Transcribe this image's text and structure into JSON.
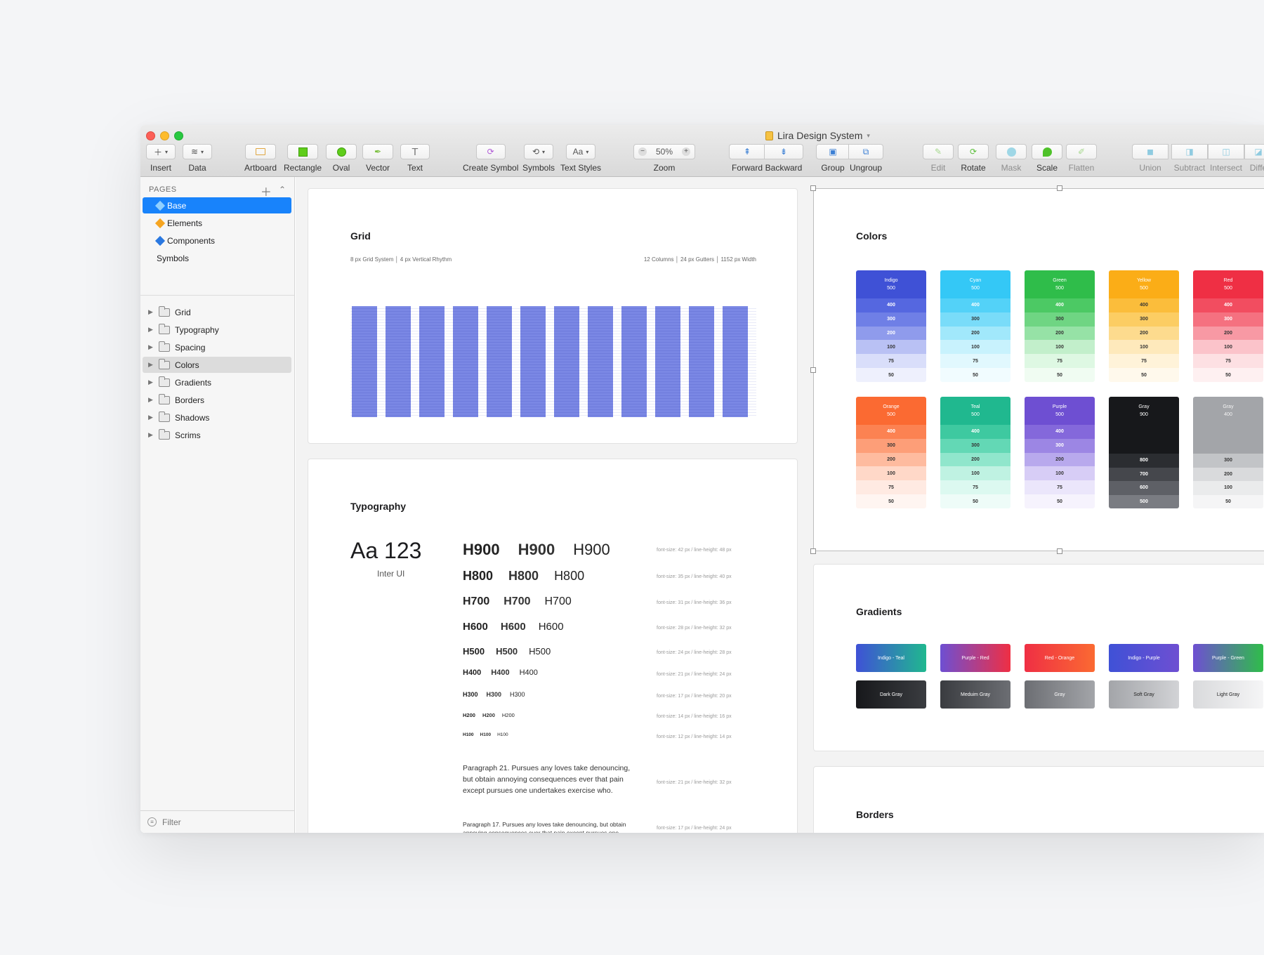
{
  "window": {
    "title": "Lira Design System"
  },
  "toolbar": {
    "insert": "Insert",
    "data": "Data",
    "artboard": "Artboard",
    "rectangle": "Rectangle",
    "oval": "Oval",
    "vector": "Vector",
    "text": "Text",
    "create_symbol": "Create Symbol",
    "symbols": "Symbols",
    "text_styles": "Text Styles",
    "text_styles_btn": "Aa",
    "zoom_label": "Zoom",
    "zoom_value": "50%",
    "forward": "Forward",
    "backward": "Backward",
    "group": "Group",
    "ungroup": "Ungroup",
    "edit": "Edit",
    "rotate": "Rotate",
    "mask": "Mask",
    "scale": "Scale",
    "flatten": "Flatten",
    "union": "Union",
    "subtract": "Subtract",
    "intersect": "Intersect",
    "difference": "Diffe"
  },
  "sidebar": {
    "pages_header": "PAGES",
    "pages": [
      "Base",
      "Elements",
      "Components",
      "Symbols"
    ],
    "layers": [
      "Grid",
      "Typography",
      "Spacing",
      "Colors",
      "Gradients",
      "Borders",
      "Shadows",
      "Scrims"
    ],
    "filter_placeholder": "Filter"
  },
  "grid": {
    "title": "Grid",
    "left_meta": "8 px Grid System │ 4 px Vertical Rhythm",
    "right_meta": "12 Columns │ 24 px Gutters │ 1152 px Width"
  },
  "typography": {
    "title": "Typography",
    "sample": "Aa 123",
    "font_name": "Inter UI",
    "headings": [
      {
        "label": "H900",
        "spec": "font-size: 42 px / line-height: 48 px"
      },
      {
        "label": "H800",
        "spec": "font-size: 35 px / line-height: 40 px"
      },
      {
        "label": "H700",
        "spec": "font-size: 31 px / line-height: 36 px"
      },
      {
        "label": "H600",
        "spec": "font-size: 28 px / line-height: 32 px"
      },
      {
        "label": "H500",
        "spec": "font-size: 24 px / line-height: 28 px"
      },
      {
        "label": "H400",
        "spec": "font-size: 21 px / line-height: 24 px"
      },
      {
        "label": "H300",
        "spec": "font-size: 17 px / line-height: 20 px"
      },
      {
        "label": "H200",
        "spec": "font-size: 14 px / line-height: 16 px"
      },
      {
        "label": "H100",
        "spec": "font-size: 12 px / line-height: 14 px"
      }
    ],
    "paragraph21": "Paragraph 21. Pursues any loves take denouncing, but obtain annoying consequences ever that pain except pursues one undertakes exercise who.",
    "paragraph21_spec": "font-size: 21 px / line-height: 32 px",
    "paragraph17": "Paragraph 17. Pursues any loves take denouncing, but obtain annoying consequences ever that pain except pursues one",
    "paragraph17_spec": "font-size: 17 px / line-height: 24 px"
  },
  "colors": {
    "title": "Colors",
    "swatches": [
      {
        "name": "Indigo",
        "main": "500",
        "head": "#3f51d6",
        "steps": [
          "400",
          "300",
          "200",
          "100",
          "75",
          "50"
        ],
        "fills": [
          "#5567e0",
          "#6f7fe6",
          "#8f9bec",
          "#b9c1f4",
          "#d9defa",
          "#eef0fd"
        ],
        "ink": [
          "#fff",
          "#fff",
          "#fff",
          "#333",
          "#333",
          "#333"
        ]
      },
      {
        "name": "Cyan",
        "main": "500",
        "head": "#34c8f6",
        "steps": [
          "400",
          "300",
          "200",
          "100",
          "75",
          "50"
        ],
        "fills": [
          "#53d2f8",
          "#79dcf9",
          "#a1e8fb",
          "#c8f2fd",
          "#e1f8fe",
          "#f1fcff"
        ],
        "ink": [
          "#fff",
          "#333",
          "#333",
          "#333",
          "#333",
          "#333"
        ]
      },
      {
        "name": "Green",
        "main": "500",
        "head": "#2fbd4a",
        "steps": [
          "400",
          "300",
          "200",
          "100",
          "75",
          "50"
        ],
        "fills": [
          "#4cc964",
          "#6fd583",
          "#96e2a6",
          "#c2efcb",
          "#def8e3",
          "#f0fcf2"
        ],
        "ink": [
          "#fff",
          "#333",
          "#333",
          "#333",
          "#333",
          "#333"
        ]
      },
      {
        "name": "Yellow",
        "main": "500",
        "head": "#fbad17",
        "steps": [
          "400",
          "300",
          "200",
          "100",
          "75",
          "50"
        ],
        "fills": [
          "#fbbd3b",
          "#fccd63",
          "#fddb8e",
          "#fee9bb",
          "#fff3d9",
          "#fff9ec"
        ],
        "ink": [
          "#333",
          "#333",
          "#333",
          "#333",
          "#333",
          "#333"
        ]
      },
      {
        "name": "Red",
        "main": "500",
        "head": "#ef2f44",
        "steps": [
          "400",
          "300",
          "200",
          "100",
          "75",
          "50"
        ],
        "fills": [
          "#f24d60",
          "#f57180",
          "#f899a4",
          "#fbc3ca",
          "#fde0e3",
          "#fef0f1"
        ],
        "ink": [
          "#fff",
          "#fff",
          "#333",
          "#333",
          "#333",
          "#333"
        ]
      },
      {
        "name": "Orange",
        "main": "500",
        "head": "#fb6a32",
        "steps": [
          "400",
          "300",
          "200",
          "100",
          "75",
          "50"
        ],
        "fills": [
          "#fc8252",
          "#fd9e78",
          "#febb9f",
          "#ffd8c8",
          "#ffeae2",
          "#fff5f1"
        ],
        "ink": [
          "#fff",
          "#333",
          "#333",
          "#333",
          "#333",
          "#333"
        ]
      },
      {
        "name": "Teal",
        "main": "500",
        "head": "#20b88f",
        "steps": [
          "400",
          "300",
          "200",
          "100",
          "75",
          "50"
        ],
        "fills": [
          "#3ec9a0",
          "#63d8b5",
          "#90e6cc",
          "#bff2e2",
          "#dcf9f0",
          "#eefcf8"
        ],
        "ink": [
          "#fff",
          "#333",
          "#333",
          "#333",
          "#333",
          "#333"
        ]
      },
      {
        "name": "Purple",
        "main": "500",
        "head": "#6e4fd2",
        "steps": [
          "400",
          "300",
          "200",
          "100",
          "75",
          "50"
        ],
        "fills": [
          "#8468db",
          "#9c86e4",
          "#b8a9ed",
          "#d7cdf6",
          "#ebe6fb",
          "#f6f3fd"
        ],
        "ink": [
          "#fff",
          "#fff",
          "#333",
          "#333",
          "#333",
          "#333"
        ]
      },
      {
        "name": "Gray",
        "main": "900",
        "head": "#17181b",
        "steps": [
          "800",
          "700",
          "600",
          "500"
        ],
        "fills": [
          "#2b2d31",
          "#45474c",
          "#5e6066",
          "#7a7c82"
        ],
        "ink": [
          "#fff",
          "#fff",
          "#fff",
          "#fff"
        ]
      },
      {
        "name": "Gray",
        "main": "400",
        "head": "#a3a5a9",
        "steps": [
          "300",
          "200",
          "100",
          "50"
        ],
        "fills": [
          "#c2c4c7",
          "#d9dadc",
          "#eaebec",
          "#f5f5f6"
        ],
        "ink": [
          "#333",
          "#333",
          "#333",
          "#333"
        ]
      }
    ]
  },
  "gradients": {
    "title": "Gradients",
    "items": [
      {
        "label": "Indigo - Teal",
        "from": "#3f51d6",
        "to": "#20b88f",
        "ink": "#fff"
      },
      {
        "label": "Purple - Red",
        "from": "#6e4fd2",
        "to": "#ef2f44",
        "ink": "#fff"
      },
      {
        "label": "Red - Orange",
        "from": "#ef2f44",
        "to": "#fb6a32",
        "ink": "#fff"
      },
      {
        "label": "Indigo - Purple",
        "from": "#3f51d6",
        "to": "#6e4fd2",
        "ink": "#fff"
      },
      {
        "label": "Purple - Green",
        "from": "#6e4fd2",
        "to": "#2fbd4a",
        "ink": "#fff"
      },
      {
        "label": "Dark Gray",
        "from": "#17181b",
        "to": "#3a3c40",
        "ink": "#fff"
      },
      {
        "label": "Meduim Gray",
        "from": "#3a3c40",
        "to": "#6c6e73",
        "ink": "#fff"
      },
      {
        "label": "Gray",
        "from": "#6c6e73",
        "to": "#a3a5a9",
        "ink": "#fff"
      },
      {
        "label": "Soft Gray",
        "from": "#a3a5a9",
        "to": "#d2d3d6",
        "ink": "#222"
      },
      {
        "label": "Light Gray",
        "from": "#d9dadc",
        "to": "#f5f5f6",
        "ink": "#222"
      }
    ]
  },
  "borders": {
    "title": "Borders"
  },
  "theme": {
    "accent": "#1883fb",
    "grid_column": "#7a87e4"
  }
}
